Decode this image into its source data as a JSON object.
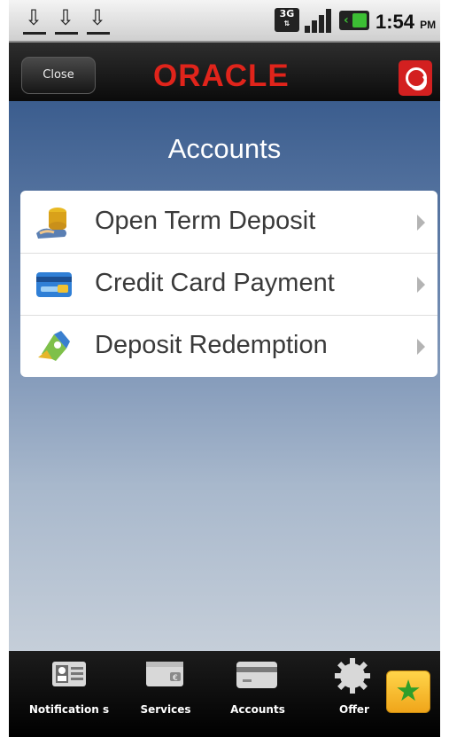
{
  "status_bar": {
    "network": "3G",
    "time": "1:54",
    "ampm": "PM",
    "download_icons": [
      "download-icon",
      "download-icon",
      "download-icon"
    ]
  },
  "header": {
    "close_label": "Close",
    "brand": "ORACLE",
    "brand_color": "#e0241b"
  },
  "content": {
    "title": "Accounts",
    "items": [
      {
        "label": "Open Term Deposit",
        "icon": "coins-icon"
      },
      {
        "label": "Credit Card Payment",
        "icon": "credit-card-icon"
      },
      {
        "label": "Deposit Redemption",
        "icon": "redemption-icon"
      }
    ]
  },
  "tabs": [
    {
      "label": "Notification s",
      "icon": "contact-card-icon"
    },
    {
      "label": "Services",
      "icon": "wallet-icon"
    },
    {
      "label": "Accounts",
      "icon": "card-icon"
    },
    {
      "label": "Offer",
      "icon": "gear-icon"
    }
  ],
  "favorite_icon": "star-icon"
}
